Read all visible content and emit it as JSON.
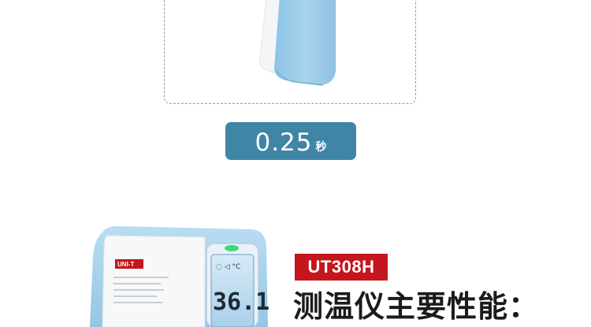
{
  "response_time": {
    "value": "0.25",
    "unit": "秒"
  },
  "product": {
    "brand": "UNI-T",
    "model_label": "UT308H",
    "screen_reading": "36.1",
    "screen_unit": "°C"
  },
  "section": {
    "heading": "测温仪主要性能："
  },
  "colors": {
    "badge": "#3f86a6",
    "tag": "#c4161c",
    "device_blue": "#a9d3ee"
  }
}
